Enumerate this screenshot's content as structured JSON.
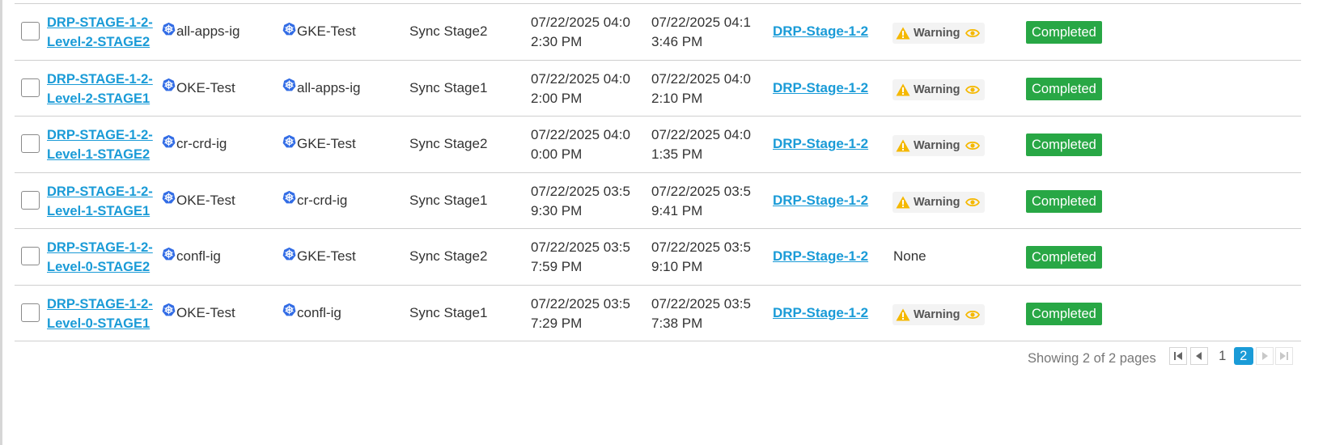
{
  "table": {
    "rows": [
      {
        "name": "DRP-STAGE-1-2-Level-2-STAGE2",
        "source_ig": "all-apps-ig",
        "target_ig": "GKE-Test",
        "stage": "Sync Stage2",
        "start": "07/22/2025 04:02:30 PM",
        "end": "07/22/2025 04:13:46 PM",
        "plan": "DRP-Stage-1-2",
        "alert": "Warning",
        "status": "Completed"
      },
      {
        "name": "DRP-STAGE-1-2-Level-2-STAGE1",
        "source_ig": "OKE-Test",
        "target_ig": "all-apps-ig",
        "stage": "Sync Stage1",
        "start": "07/22/2025 04:02:00 PM",
        "end": "07/22/2025 04:02:10 PM",
        "plan": "DRP-Stage-1-2",
        "alert": "Warning",
        "status": "Completed"
      },
      {
        "name": "DRP-STAGE-1-2-Level-1-STAGE2",
        "source_ig": "cr-crd-ig",
        "target_ig": "GKE-Test",
        "stage": "Sync Stage2",
        "start": "07/22/2025 04:00:00 PM",
        "end": "07/22/2025 04:01:35 PM",
        "plan": "DRP-Stage-1-2",
        "alert": "Warning",
        "status": "Completed"
      },
      {
        "name": "DRP-STAGE-1-2-Level-1-STAGE1",
        "source_ig": "OKE-Test",
        "target_ig": "cr-crd-ig",
        "stage": "Sync Stage1",
        "start": "07/22/2025 03:59:30 PM",
        "end": "07/22/2025 03:59:41 PM",
        "plan": "DRP-Stage-1-2",
        "alert": "Warning",
        "status": "Completed"
      },
      {
        "name": "DRP-STAGE-1-2-Level-0-STAGE2",
        "source_ig": "confl-ig",
        "target_ig": "GKE-Test",
        "stage": "Sync Stage2",
        "start": "07/22/2025 03:57:59 PM",
        "end": "07/22/2025 03:59:10 PM",
        "plan": "DRP-Stage-1-2",
        "alert": "None",
        "status": "Completed"
      },
      {
        "name": "DRP-STAGE-1-2-Level-0-STAGE1",
        "source_ig": "OKE-Test",
        "target_ig": "confl-ig",
        "stage": "Sync Stage1",
        "start": "07/22/2025 03:57:29 PM",
        "end": "07/22/2025 03:57:38 PM",
        "plan": "DRP-Stage-1-2",
        "alert": "Warning",
        "status": "Completed"
      }
    ]
  },
  "pagination": {
    "summary": "Showing 2 of 2 pages",
    "pages": [
      "1",
      "2"
    ],
    "current": "2"
  },
  "colors": {
    "link": "#1a9bd7",
    "completed": "#28a745",
    "warning": "#f5b800"
  },
  "icons": {
    "ig": "kubernetes-icon",
    "warning": "warning-triangle-icon",
    "view": "eye-icon"
  }
}
